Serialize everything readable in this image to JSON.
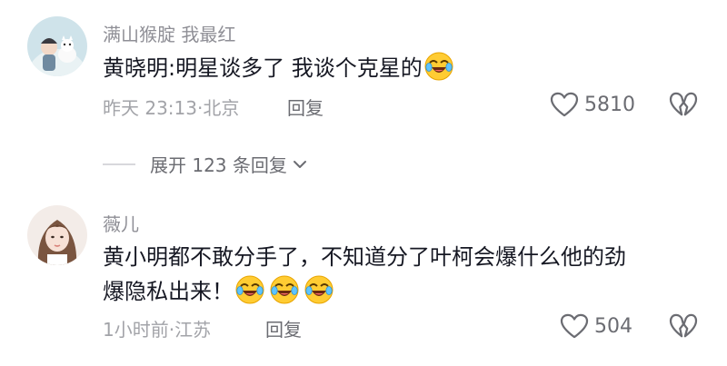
{
  "comments": [
    {
      "username": "满山猴腚 我最红",
      "text": "黄晓明:明星谈多了 我谈个克星的",
      "emoji": "laugh-crying-emoji",
      "time_location": "昨天 23:13·北京",
      "reply_label": "回复",
      "likes": "5810",
      "expand_label": "展开 123 条回复"
    },
    {
      "username": "薇儿",
      "text_line1": "黄小明都不敢分手了，不知道分了叶柯会爆什么他的劲",
      "text_line2": "爆隐私出来！",
      "emoji": "laugh-crying-emoji",
      "time_location": "1小时前·江苏",
      "reply_label": "回复",
      "likes": "504"
    }
  ],
  "icons": {
    "like": "heart-outline-icon",
    "dislike": "broken-heart-icon",
    "expand": "chevron-down-icon"
  },
  "colors": {
    "text_primary": "#161823",
    "text_secondary": "#8f8f96",
    "icon": "#6b6c72"
  }
}
